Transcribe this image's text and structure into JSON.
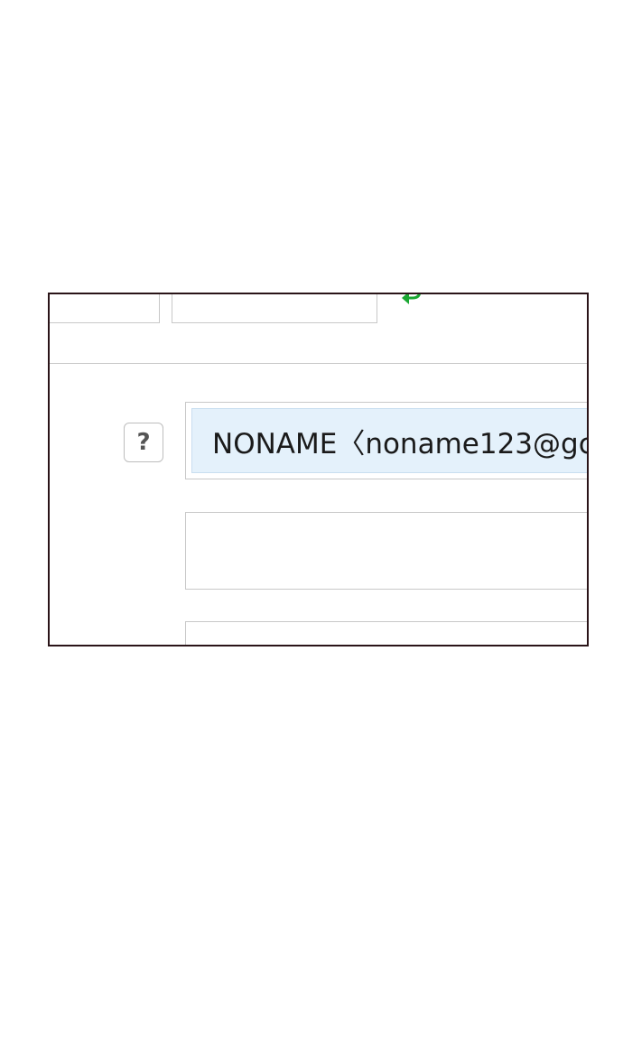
{
  "form": {
    "recipient_value": "NONAME〈noname123@gc",
    "help_label": "?",
    "second_field_value": "",
    "third_field_value": ""
  },
  "icons": {
    "help": "question-mark-icon",
    "arrow": "return-arrow-icon"
  },
  "colors": {
    "selection_bg": "#e4f1fb",
    "arrow_green": "#1aa832",
    "frame_border": "#2a1418"
  }
}
